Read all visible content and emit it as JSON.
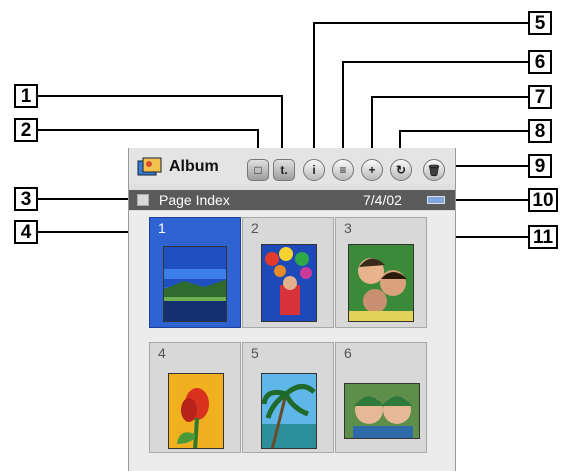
{
  "app": {
    "title": "Album",
    "icon": "album-icon"
  },
  "toolbar_buttons": [
    {
      "name": "stop-button",
      "icon": "stop-icon",
      "glyph": "□"
    },
    {
      "name": "transfer-button",
      "icon": "transfer-icon",
      "glyph": "t."
    },
    {
      "name": "info-button",
      "icon": "info-icon",
      "glyph": "i"
    },
    {
      "name": "menu-button",
      "icon": "menu-icon",
      "glyph": "≡"
    },
    {
      "name": "zoom-button",
      "icon": "zoom-icon",
      "glyph": "+"
    },
    {
      "name": "rotate-button",
      "icon": "rotate-icon",
      "glyph": "↻"
    },
    {
      "name": "delete-button",
      "icon": "trash-icon",
      "glyph": "🗑"
    }
  ],
  "status": {
    "page_index": "Page Index",
    "date": "7/4/02",
    "battery_icon": "battery-icon"
  },
  "thumbnails": [
    {
      "number": "1",
      "selected": true
    },
    {
      "number": "2",
      "selected": false
    },
    {
      "number": "3",
      "selected": false
    },
    {
      "number": "4",
      "selected": false
    },
    {
      "number": "5",
      "selected": false
    },
    {
      "number": "6",
      "selected": false
    }
  ],
  "callouts": [
    "1",
    "2",
    "3",
    "4",
    "5",
    "6",
    "7",
    "8",
    "9",
    "10",
    "11"
  ],
  "colors": {
    "selection": "#2f63d2",
    "statusbar": "#5a5a5a",
    "accent_blue": "#7fa6e0"
  }
}
